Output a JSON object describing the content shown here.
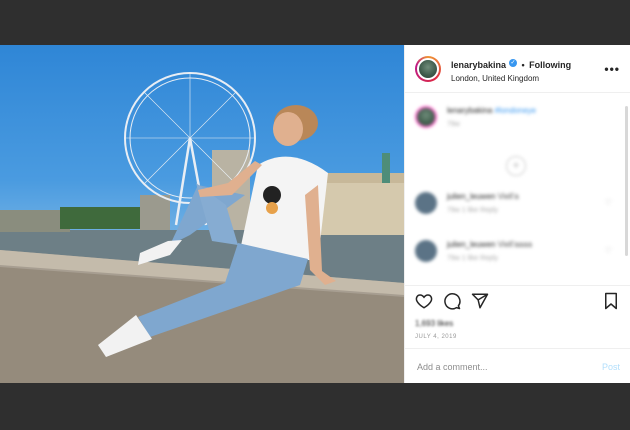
{
  "header": {
    "username": "lenarybakina",
    "verified_icon": "verified-badge-icon",
    "separator": "•",
    "follow_status": "Following",
    "location": "London, United Kingdom",
    "more_label": "•••"
  },
  "comments": {
    "caption": {
      "username": "lenarybakina",
      "text": "#londoneye",
      "meta": "79w"
    },
    "items": [
      {
        "username": "julien_leuwen",
        "text": "Viell'a",
        "meta": "79w   1 like   Reply"
      },
      {
        "username": "julien_leuwen",
        "text": "Viell'aaaa",
        "meta": "79w   1 like   Reply"
      }
    ]
  },
  "actions": {
    "likes": "1,693 likes",
    "date": "JULY 4, 2019"
  },
  "add_comment": {
    "placeholder": "Add a comment...",
    "post_label": "Post"
  },
  "colors": {
    "backdrop": "#2f2f2f",
    "accent_blue": "#3897f0",
    "post_disabled": "#b2dffc"
  }
}
